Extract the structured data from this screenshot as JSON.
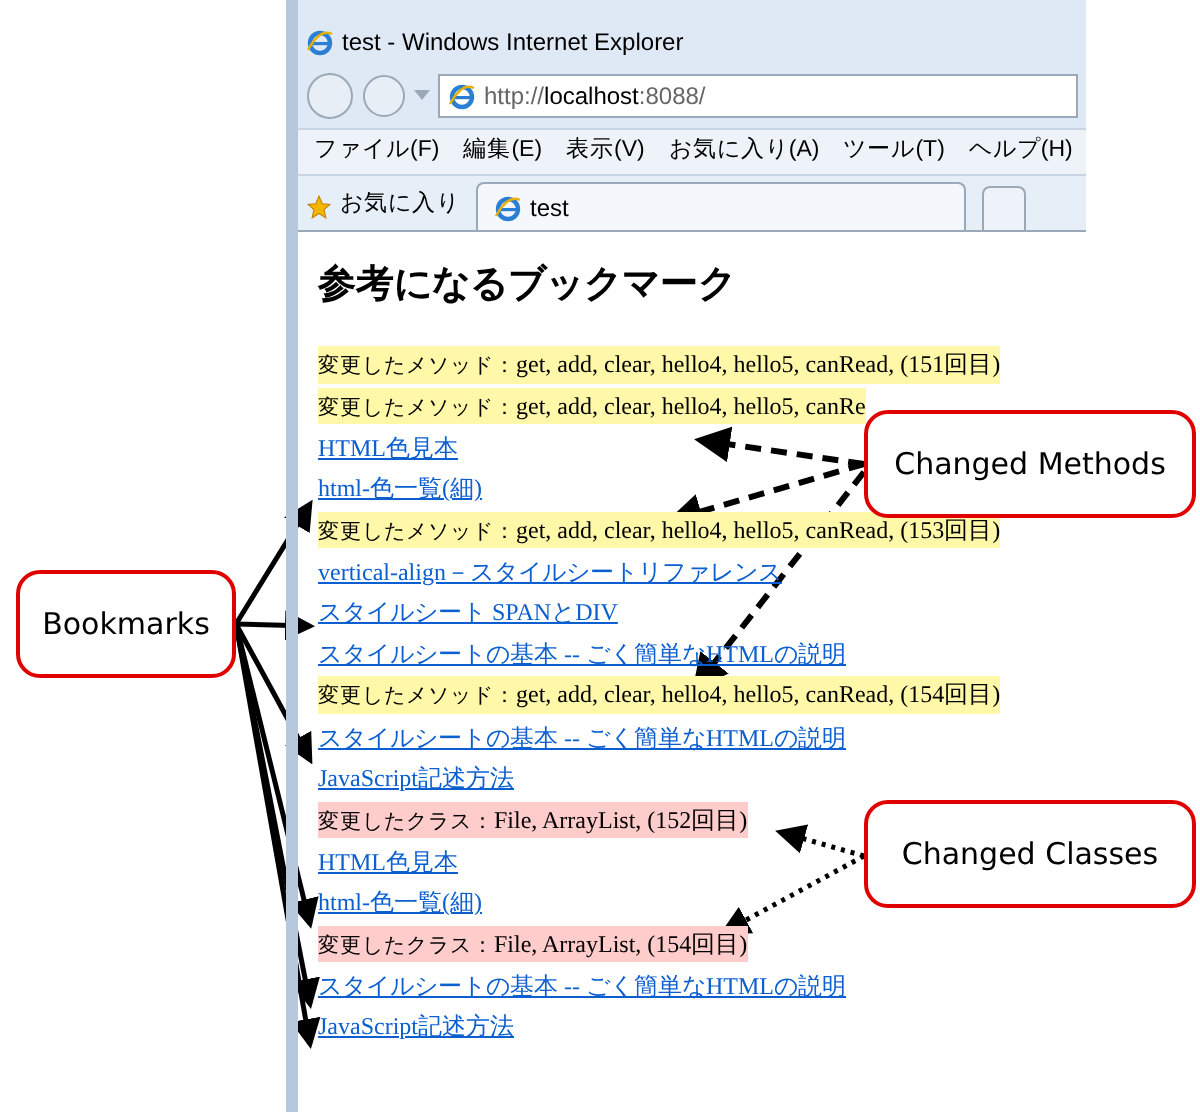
{
  "window": {
    "title": "test - Windows Internet Explorer"
  },
  "address_bar": {
    "scheme": "http://",
    "host": "localhost",
    "rest": ":8088/"
  },
  "menu_bar": [
    "ファイル(F)",
    "編集(E)",
    "表示(V)",
    "お気に入り(A)",
    "ツール(T)",
    "ヘルプ(H)"
  ],
  "favorites_bar": {
    "label": "お気に入り",
    "tabs": [
      {
        "label": "test",
        "selected": true
      }
    ]
  },
  "page": {
    "heading": "参考になるブックマーク",
    "items": [
      {
        "kind": "method",
        "label": "変更したメソッド：",
        "text": "get, add, clear, hello4, hello5, canRead, (151回目)"
      },
      {
        "kind": "method",
        "label": "変更したメソッド：",
        "text": "get, add, clear, hello4, hello5, canRe"
      },
      {
        "kind": "link",
        "text": "HTML色見本"
      },
      {
        "kind": "link",
        "text": "html-色一覧(細)"
      },
      {
        "kind": "method",
        "label": "変更したメソッド：",
        "text": "get, add, clear, hello4, hello5, canRead, (153回目)"
      },
      {
        "kind": "link",
        "text": "vertical-align－スタイルシートリファレンス"
      },
      {
        "kind": "link",
        "text": "スタイルシート SPANとDIV"
      },
      {
        "kind": "link",
        "text": "スタイルシートの基本 -- ごく簡単なHTMLの説明"
      },
      {
        "kind": "method",
        "label": "変更したメソッド：",
        "text": "get, add, clear, hello4, hello5, canRead, (154回目)"
      },
      {
        "kind": "link",
        "text": "スタイルシートの基本 -- ごく簡単なHTMLの説明"
      },
      {
        "kind": "link",
        "text": "JavaScript記述方法"
      },
      {
        "kind": "class",
        "label": "変更したクラス：",
        "text": "File, ArrayList, (152回目)"
      },
      {
        "kind": "link",
        "text": "HTML色見本"
      },
      {
        "kind": "link",
        "text": "html-色一覧(細)"
      },
      {
        "kind": "class",
        "label": "変更したクラス：",
        "text": "File, ArrayList, (154回目)"
      },
      {
        "kind": "link",
        "text": "スタイルシートの基本 -- ごく簡単なHTMLの説明"
      },
      {
        "kind": "link",
        "text": "JavaScript記述方法"
      }
    ]
  },
  "callouts": [
    {
      "label": "Bookmarks"
    },
    {
      "label": "Changed Methods"
    },
    {
      "label": "Changed Classes"
    }
  ]
}
